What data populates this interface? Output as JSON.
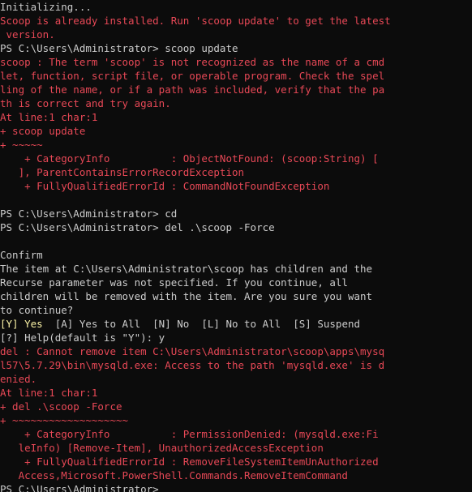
{
  "terminal": {
    "lines": [
      {
        "text": "Initializing...",
        "color": "w"
      },
      {
        "text": "Scoop is already installed. Run 'scoop update' to get the latest",
        "color": "r"
      },
      {
        "text": " version.",
        "color": "r"
      },
      {
        "text": "PS C:\\Users\\Administrator> scoop update",
        "color": "w"
      },
      {
        "text": "scoop : The term 'scoop' is not recognized as the name of a cmd",
        "color": "r"
      },
      {
        "text": "let, function, script file, or operable program. Check the spel",
        "color": "r"
      },
      {
        "text": "ling of the name, or if a path was included, verify that the pa",
        "color": "r"
      },
      {
        "text": "th is correct and try again.",
        "color": "r"
      },
      {
        "text": "At line:1 char:1",
        "color": "r"
      },
      {
        "text": "+ scoop update",
        "color": "r"
      },
      {
        "text": "+ ~~~~~",
        "color": "r"
      },
      {
        "text": "    + CategoryInfo          : ObjectNotFound: (scoop:String) [",
        "color": "r"
      },
      {
        "text": "   ], ParentContainsErrorRecordException",
        "color": "r"
      },
      {
        "text": "    + FullyQualifiedErrorId : CommandNotFoundException",
        "color": "r"
      },
      {
        "text": "",
        "color": "w"
      },
      {
        "text": "PS C:\\Users\\Administrator> cd",
        "color": "w"
      },
      {
        "text": "PS C:\\Users\\Administrator> del .\\scoop -Force",
        "color": "w"
      },
      {
        "text": "",
        "color": "w"
      },
      {
        "text": "Confirm",
        "color": "w"
      },
      {
        "text": "The item at C:\\Users\\Administrator\\scoop has children and the",
        "color": "w"
      },
      {
        "text": "Recurse parameter was not specified. If you continue, all",
        "color": "w"
      },
      {
        "text": "children will be removed with the item. Are you sure you want",
        "color": "w"
      },
      {
        "text": "to continue?",
        "color": "w"
      },
      {
        "text": "",
        "color": "w",
        "segments": [
          {
            "text": "[Y] Yes",
            "color": "y"
          },
          {
            "text": "  [A] Yes to All  [N] No  [L] No to All  [S] Suspend",
            "color": "w"
          }
        ]
      },
      {
        "text": "[?] Help(default is \"Y\"): y",
        "color": "w"
      },
      {
        "text": "del : Cannot remove item C:\\Users\\Administrator\\scoop\\apps\\mysq",
        "color": "r"
      },
      {
        "text": "l57\\5.7.29\\bin\\mysqld.exe: Access to the path 'mysqld.exe' is d",
        "color": "r"
      },
      {
        "text": "enied.",
        "color": "r"
      },
      {
        "text": "At line:1 char:1",
        "color": "r"
      },
      {
        "text": "+ del .\\scoop -Force",
        "color": "r"
      },
      {
        "text": "+ ~~~~~~~~~~~~~~~~~~~",
        "color": "r"
      },
      {
        "text": "    + CategoryInfo          : PermissionDenied: (mysqld.exe:Fi",
        "color": "r"
      },
      {
        "text": "   leInfo) [Remove-Item], UnauthorizedAccessException",
        "color": "r"
      },
      {
        "text": "    + FullyQualifiedErrorId : RemoveFileSystemItemUnAuthorized",
        "color": "r"
      },
      {
        "text": "   Access,Microsoft.PowerShell.Commands.RemoveItemCommand",
        "color": "r"
      },
      {
        "text": "PS C:\\Users\\Administrator>",
        "color": "w"
      }
    ]
  },
  "colors": {
    "background": "#0c0c0c",
    "text": "#cccccc",
    "error": "#e74856",
    "highlight": "#f9f1a5"
  }
}
